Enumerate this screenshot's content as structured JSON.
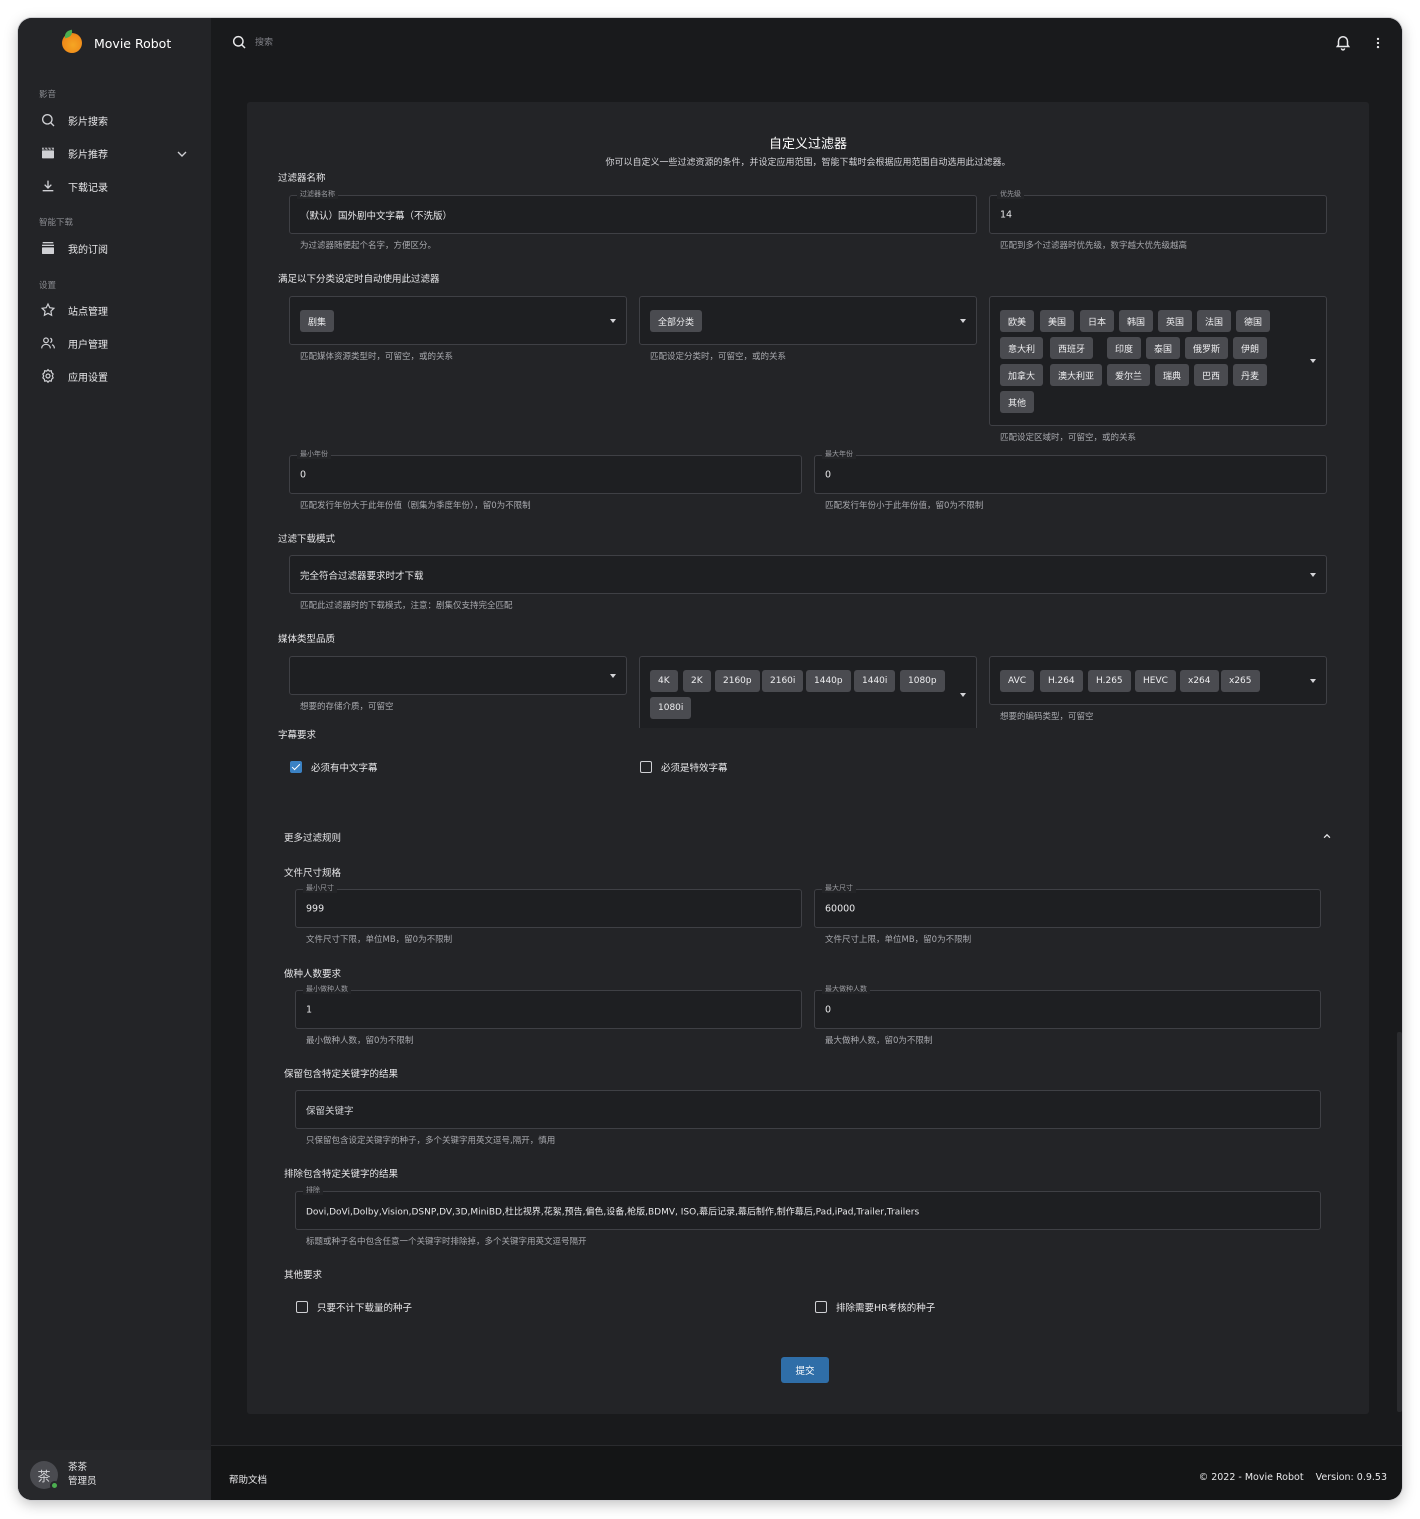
{
  "app": {
    "name": "Movie Robot"
  },
  "search": {
    "placeholder": "搜索"
  },
  "sidebar": {
    "sections": [
      "影音",
      "智能下载",
      "设置"
    ],
    "items": [
      {
        "label": "影片搜索",
        "icon": "search-icon"
      },
      {
        "label": "影片推荐",
        "icon": "film-icon"
      },
      {
        "label": "下载记录",
        "icon": "download-icon"
      },
      {
        "label": "我的订阅",
        "icon": "subscription-icon"
      },
      {
        "label": "站点管理",
        "icon": "star-icon"
      },
      {
        "label": "用户管理",
        "icon": "users-icon"
      },
      {
        "label": "应用设置",
        "icon": "gear-icon"
      }
    ]
  },
  "user": {
    "avatar_char": "茶",
    "name": "茶茶",
    "role": "管理员"
  },
  "form": {
    "title": "自定义过滤器",
    "subtitle": "你可以自定义一些过滤资源的条件，并设定应用范围，智能下载时会根据应用范围自动选用此过滤器。",
    "name_section": "过滤器名称",
    "name_field": {
      "label": "过滤器名称",
      "value": "（默认）国外剧中文字幕（不洗版）",
      "hint": "为过滤器随便起个名字，方便区分。"
    },
    "priority_field": {
      "label": "优先级",
      "value": "14",
      "hint": "匹配到多个过滤器时优先级，数字越大优先级越高"
    },
    "category_section": "满足以下分类设定时自动使用此过滤器",
    "media_type": {
      "chip": "剧集",
      "hint": "匹配媒体资源类型时，可留空，或的关系"
    },
    "category": {
      "chip": "全部分类",
      "hint": "匹配设定分类时，可留空，或的关系"
    },
    "regions": {
      "chips": [
        "欧美",
        "美国",
        "日本",
        "韩国",
        "英国",
        "法国",
        "德国",
        "意大利",
        "西班牙",
        "印度",
        "泰国",
        "俄罗斯",
        "伊朗",
        "加拿大",
        "澳大利亚",
        "爱尔兰",
        "瑞典",
        "巴西",
        "丹麦",
        "其他"
      ],
      "hint": "匹配设定区域时，可留空，或的关系"
    },
    "min_year": {
      "label": "最小年份",
      "value": "0",
      "hint": "匹配发行年份大于此年份值（剧集为季度年份），留0为不限制"
    },
    "max_year": {
      "label": "最大年份",
      "value": "0",
      "hint": "匹配发行年份小于此年份值，留0为不限制"
    },
    "mode_section": "过滤下载模式",
    "mode": {
      "value": "完全符合过滤器要求时才下载",
      "hint": "匹配此过滤器时的下载模式，注意：剧集仅支持完全匹配"
    },
    "quality_section": "媒体类型品质",
    "media": {
      "value": "",
      "hint": "想要的存储介质，可留空"
    },
    "resolutions": [
      "4K",
      "2K",
      "2160p",
      "2160i",
      "1440p",
      "1440i",
      "1080p",
      "1080i"
    ],
    "codecs": {
      "chips": [
        "AVC",
        "H.264",
        "H.265",
        "HEVC",
        "x264",
        "x265"
      ],
      "hint": "想要的编码类型，可留空"
    },
    "subtitle_section": "字幕要求",
    "cb_chinese": {
      "label": "必须有中文字幕",
      "checked": true
    },
    "cb_effects": {
      "label": "必须是特效字幕",
      "checked": false
    },
    "more_rules": "更多过滤规则",
    "size_section": "文件尺寸规格",
    "min_size": {
      "label": "最小尺寸",
      "value": "999",
      "hint": "文件尺寸下限，单位MB，留0为不限制"
    },
    "max_size": {
      "label": "最大尺寸",
      "value": "60000",
      "hint": "文件尺寸上限，单位MB，留0为不限制"
    },
    "seed_section": "做种人数要求",
    "min_seed": {
      "label": "最小做种人数",
      "value": "1",
      "hint": "最小做种人数，留0为不限制"
    },
    "max_seed": {
      "label": "最大做种人数",
      "value": "0",
      "hint": "最大做种人数，留0为不限制"
    },
    "keep_section": "保留包含特定关键字的结果",
    "keep": {
      "placeholder": "保留关键字",
      "hint": "只保留包含设定关键字的种子，多个关键字用英文逗号,隔开，慎用"
    },
    "exclude_section": "排除包含特定关键字的结果",
    "exclude": {
      "label": "排除",
      "value": "Dovi,DoVi,Dolby,Vision,DSNP,DV,3D,MiniBD,杜比视界,花絮,预告,偏色,设备,枪版,BDMV, ISO,幕后记录,幕后制作,制作幕后,Pad,iPad,Trailer,Trailers",
      "hint": "标题或种子名中包含任意一个关键字时排除掉，多个关键字用英文逗号隔开"
    },
    "other_section": "其他要求",
    "cb_free": {
      "label": "只要不计下载量的种子",
      "checked": false
    },
    "cb_hr": {
      "label": "排除需要HR考核的种子",
      "checked": false
    },
    "submit": "提交"
  },
  "footer": {
    "help": "帮助文档",
    "copyright": "© 2022 - Movie Robot    Version: 0.9.53"
  }
}
